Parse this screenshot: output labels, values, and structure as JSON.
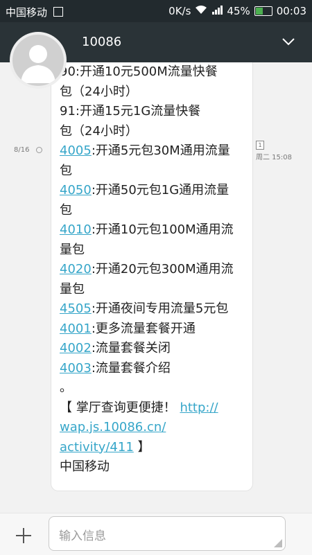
{
  "status_bar": {
    "carrier": "中国移动",
    "sim_icon": "sim-card-icon",
    "speed": "0K/s",
    "battery_percent": "45%",
    "battery_level": 0.45,
    "time": "00:03"
  },
  "header": {
    "contact": "10086",
    "avatar_icon": "person-avatar-icon",
    "expand_icon": "chevron-down-icon"
  },
  "message": {
    "date": "8/16",
    "sim": "1",
    "time": "周二 15:08",
    "lines": [
      {
        "code": "",
        "text": "90:开通10元500M流量快餐"
      },
      {
        "code": "",
        "text": "包（24小时）"
      },
      {
        "code": "",
        "text": "91:开通15元1G流量快餐"
      },
      {
        "code": "",
        "text": "包（24小时）"
      },
      {
        "code": "4005",
        "text": ":开通5元包30M通用流量"
      },
      {
        "code": "",
        "text": "包"
      },
      {
        "code": "4050",
        "text": ":开通50元包1G通用流量"
      },
      {
        "code": "",
        "text": "包"
      },
      {
        "code": "4010",
        "text": ":开通10元包100M通用流"
      },
      {
        "code": "",
        "text": "量包"
      },
      {
        "code": "4020",
        "text": ":开通20元包300M通用流"
      },
      {
        "code": "",
        "text": "量包"
      },
      {
        "code": "4505",
        "text": ":开通夜间专用流量5元包"
      },
      {
        "code": "4001",
        "text": ":更多流量套餐开通"
      },
      {
        "code": "4002",
        "text": ":流量套餐关闭"
      },
      {
        "code": "4003",
        "text": ":流量套餐介绍"
      },
      {
        "code": "",
        "text": "。"
      },
      {
        "code": "",
        "text": "【 掌厅查询更便捷！ ",
        "link": "http://"
      },
      {
        "code": "",
        "text": "",
        "link": "wap.js.10086.cn/"
      },
      {
        "code": "",
        "text": " 】",
        "link_before": "activity/411"
      },
      {
        "code": "",
        "text": "中国移动"
      }
    ]
  },
  "composer": {
    "placeholder": "输入信息",
    "add_icon": "plus-icon"
  }
}
